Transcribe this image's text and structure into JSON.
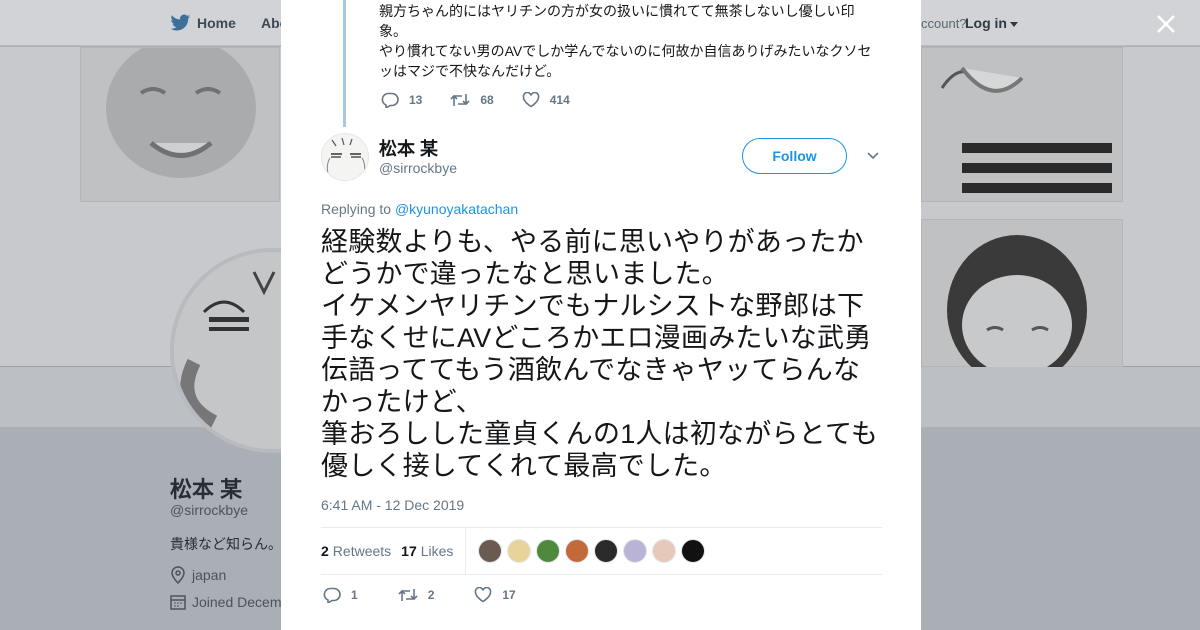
{
  "background": {
    "nav": {
      "home_label": "Home",
      "about_label": "Abo",
      "account_text": "ccount?",
      "login_label": "Log in"
    },
    "profile": {
      "name": "松本 某",
      "handle": "@sirrockbye",
      "bio": "貴様など知らん。",
      "location": "japan",
      "joined": "Joined Decem"
    }
  },
  "parent_tweet": {
    "text": "親方ちゃん的にはヤリチンの方が女の扱いに慣れてて無茶しないし優しい印象。\nやり慣れてない男のAVでしか学んでないのに何故か自信ありげみたいなクソセッはマジで不快なんだけど。",
    "replies": "13",
    "retweets": "68",
    "likes": "414"
  },
  "tweet": {
    "author_name": "松本 某",
    "author_handle": "@sirrockbye",
    "follow_label": "Follow",
    "replying_prefix": "Replying to",
    "replying_to": "@kyunoyakatachan",
    "text": "経験数よりも、やる前に思いやりがあったかどうかで違ったなと思いました。\nイケメンヤリチンでもナルシストな野郎は下手なくせにAVどころかエロ漫画みたいな武勇伝語っててもう酒飲んでなきゃヤッてらんなかったけど、\n筆おろしした童貞くんの1人は初ながらとても優しく接してくれて最高でした。",
    "timestamp": "6:41 AM - 12 Dec 2019",
    "retweet_count": "2",
    "retweet_label": "Retweets",
    "like_count": "17",
    "like_label": "Likes",
    "likers": [
      {
        "color": "#6b5a52"
      },
      {
        "color": "#e8d49a"
      },
      {
        "color": "#4f8a3c"
      },
      {
        "color": "#c46a3a"
      },
      {
        "color": "#2a2a2a"
      },
      {
        "color": "#b9b3d6"
      },
      {
        "color": "#e7c9b8"
      },
      {
        "color": "#111111"
      }
    ],
    "actions": {
      "replies": "1",
      "retweets": "2",
      "likes": "17"
    }
  },
  "colors": {
    "accent": "#1b95e0",
    "muted": "#657786",
    "thread_line": "#a8c8e2"
  },
  "icons": [
    "twitter-bird-icon",
    "close-icon",
    "reply-icon",
    "retweet-icon",
    "heart-icon",
    "chevron-down-icon",
    "location-icon",
    "calendar-icon"
  ]
}
